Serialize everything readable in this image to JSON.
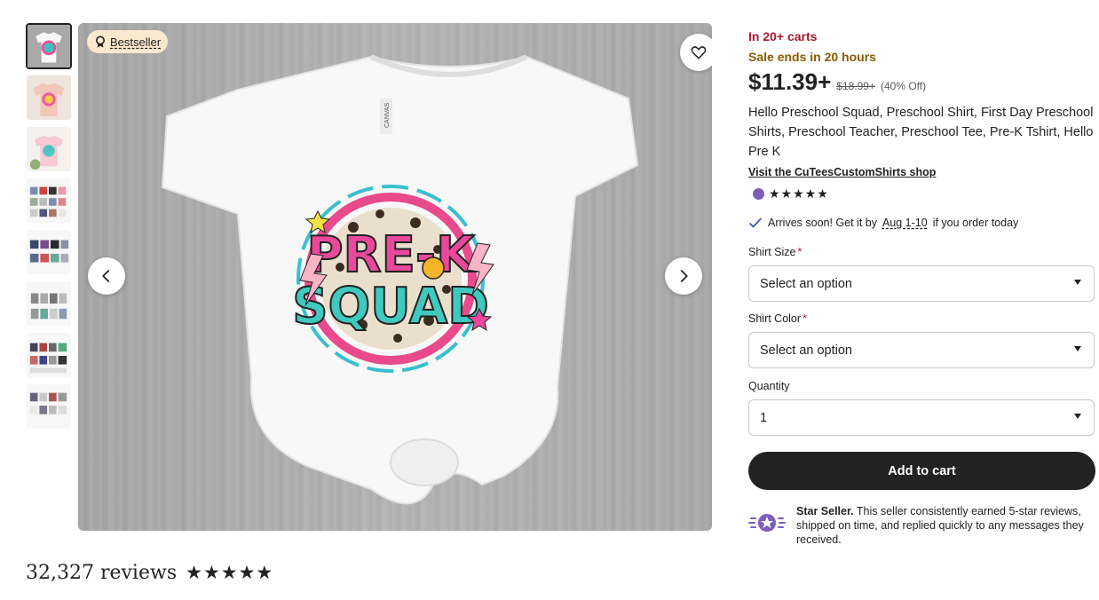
{
  "gallery": {
    "badge_label": "Bestseller",
    "thumbnail_count": 8,
    "active_index": 0
  },
  "shirt_graphic": {
    "line1": "PRE-K",
    "line2": "SQUAD",
    "neck_tag": "CANVAS"
  },
  "listing": {
    "in_carts": "In 20+ carts",
    "sale_ends": "Sale ends in 20 hours",
    "price": "$11.39+",
    "original_price": "$18.99+",
    "discount": "(40% Off)",
    "title": "Hello Preschool Squad, Preschool Shirt, First Day Preschool Shirts, Preschool Teacher, Preschool Tee, Pre-K Tshirt, Hello Pre K",
    "shop_link": "Visit the CuTeesCustomShirts shop",
    "shop_rating_stars": "★★★★★",
    "arrives_prefix": "Arrives soon! Get it by",
    "arrives_date": "Aug 1-10",
    "arrives_suffix": "if you order today"
  },
  "options": {
    "size_label": "Shirt Size",
    "size_value": "Select an option",
    "color_label": "Shirt Color",
    "color_value": "Select an option",
    "quantity_label": "Quantity",
    "quantity_value": "1",
    "required_mark": "*"
  },
  "cart": {
    "add_label": "Add to cart"
  },
  "star_seller": {
    "heading": "Star Seller.",
    "body": "This seller consistently earned 5-star reviews, shipped on time, and replied quickly to any messages they received."
  },
  "reviews": {
    "count_text": "32,327 reviews",
    "stars": "★★★★★"
  },
  "colors": {
    "accent_dark": "#222222",
    "urgency_red": "#a61a2e",
    "sale_gold": "#8a5a00",
    "badge_bg": "#fce8cc",
    "star_seller_purple": "#7d5dbd"
  }
}
